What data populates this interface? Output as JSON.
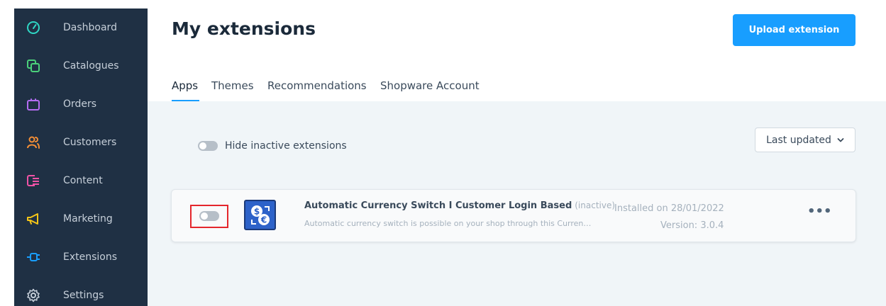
{
  "sidebar": {
    "items": [
      {
        "label": "Dashboard",
        "icon": "gauge-icon",
        "color": "#2fd6c4"
      },
      {
        "label": "Catalogues",
        "icon": "catalogues-icon",
        "color": "#4bd07a"
      },
      {
        "label": "Orders",
        "icon": "orders-bag-icon",
        "color": "#b46cf2"
      },
      {
        "label": "Customers",
        "icon": "customers-icon",
        "color": "#f48f36"
      },
      {
        "label": "Content",
        "icon": "content-icon",
        "color": "#ef53a6"
      },
      {
        "label": "Marketing",
        "icon": "megaphone-icon",
        "color": "#f5c518"
      },
      {
        "label": "Extensions",
        "icon": "plug-icon",
        "color": "#189eff"
      },
      {
        "label": "Settings",
        "icon": "gear-icon",
        "color": "#c6cfd9"
      }
    ]
  },
  "header": {
    "title": "My extensions",
    "upload_label": "Upload extension"
  },
  "tabs": [
    {
      "label": "Apps",
      "active": true
    },
    {
      "label": "Themes",
      "active": false
    },
    {
      "label": "Recommendations",
      "active": false
    },
    {
      "label": "Shopware Account",
      "active": false
    }
  ],
  "filters": {
    "hide_inactive_label": "Hide inactive extensions",
    "sort_label": "Last updated"
  },
  "extension": {
    "name": "Automatic Currency Switch I Customer Login Based",
    "status": "(inactive)",
    "description": "Automatic currency switch is possible on your shop through this Curren…",
    "installed": "Installed on 28/01/2022",
    "version": "Version: 3.0.4",
    "menu": "•••"
  },
  "colors": {
    "accent": "#189eff",
    "sidebar_bg": "#1f3044",
    "highlight": "#e4262c"
  }
}
